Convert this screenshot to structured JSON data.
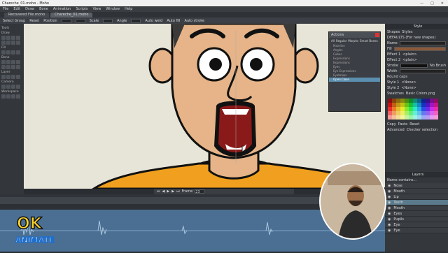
{
  "window": {
    "title": "Chareche_01.moho - Moho"
  },
  "menu": [
    "File",
    "Edit",
    "Draw",
    "Bone",
    "Animation",
    "Scripts",
    "View",
    "Window",
    "Help"
  ],
  "tabs": [
    "Recovered File.moho",
    "Chareche_01.moho"
  ],
  "toolopts": {
    "select_group": "Select Group",
    "reset": "Reset",
    "position": "Position",
    "scale": "Scale",
    "angle": "Angle",
    "auto_weld": "Auto weld",
    "auto_fill": "Auto fill",
    "auto_stroke": "Auto stroke"
  },
  "leftpanel": {
    "title": "Tools",
    "sections": [
      "Draw",
      "Fill",
      "Bone",
      "Layer",
      "Camera",
      "Workspace"
    ]
  },
  "actions": {
    "title": "Actions",
    "tabs": [
      "All",
      "Regular",
      "Morphs",
      "Smart Bones"
    ],
    "items": [
      "Mainline",
      "Angles",
      "Cubes",
      "Expressions",
      "Expressions",
      "Eyes",
      "Eye Expressions",
      "Eyebrows",
      "Open Close"
    ],
    "selected": "Open Close"
  },
  "style": {
    "title": "Style",
    "shapes": "Shapes",
    "styles": "Styles",
    "defaults": "DEFAULTS (For new shapes)",
    "name": "Name",
    "fill": "Fill",
    "stroke": "Stroke",
    "effect1": "Effect 1",
    "effect2": "Effect 2",
    "effect_val": "<plain>",
    "width": "Width",
    "no_brush": "No Brush",
    "round_caps": "Round caps",
    "style1": "Style 1",
    "style2": "Style 2",
    "none": "<None>",
    "swatches": "Swatches",
    "basic_colors": "Basic Colors.png",
    "copy": "Copy",
    "paste": "Paste",
    "reset": "Reset",
    "advanced": "Advanced",
    "checker": "Checker selection"
  },
  "layers": {
    "title": "Layers",
    "search": "Name contains...",
    "items": [
      "Nose",
      "Mouth",
      "Lip",
      "Teeth",
      "Mouth",
      "Eyes",
      "Pupils",
      "Eye",
      "Eye"
    ],
    "selected_index": 3
  },
  "timeline": {
    "frame_label": "Frame",
    "frame": "23"
  },
  "colors": {
    "bg": "#2a2d31",
    "canvas": "#e7e5d8",
    "skin": "#e6b488",
    "hair": "#3a3a3a",
    "shirt": "#f0a01e",
    "selection": "#5b8fb0"
  },
  "logo": {
    "line1": "OK",
    "line2": "ANIMATE"
  }
}
